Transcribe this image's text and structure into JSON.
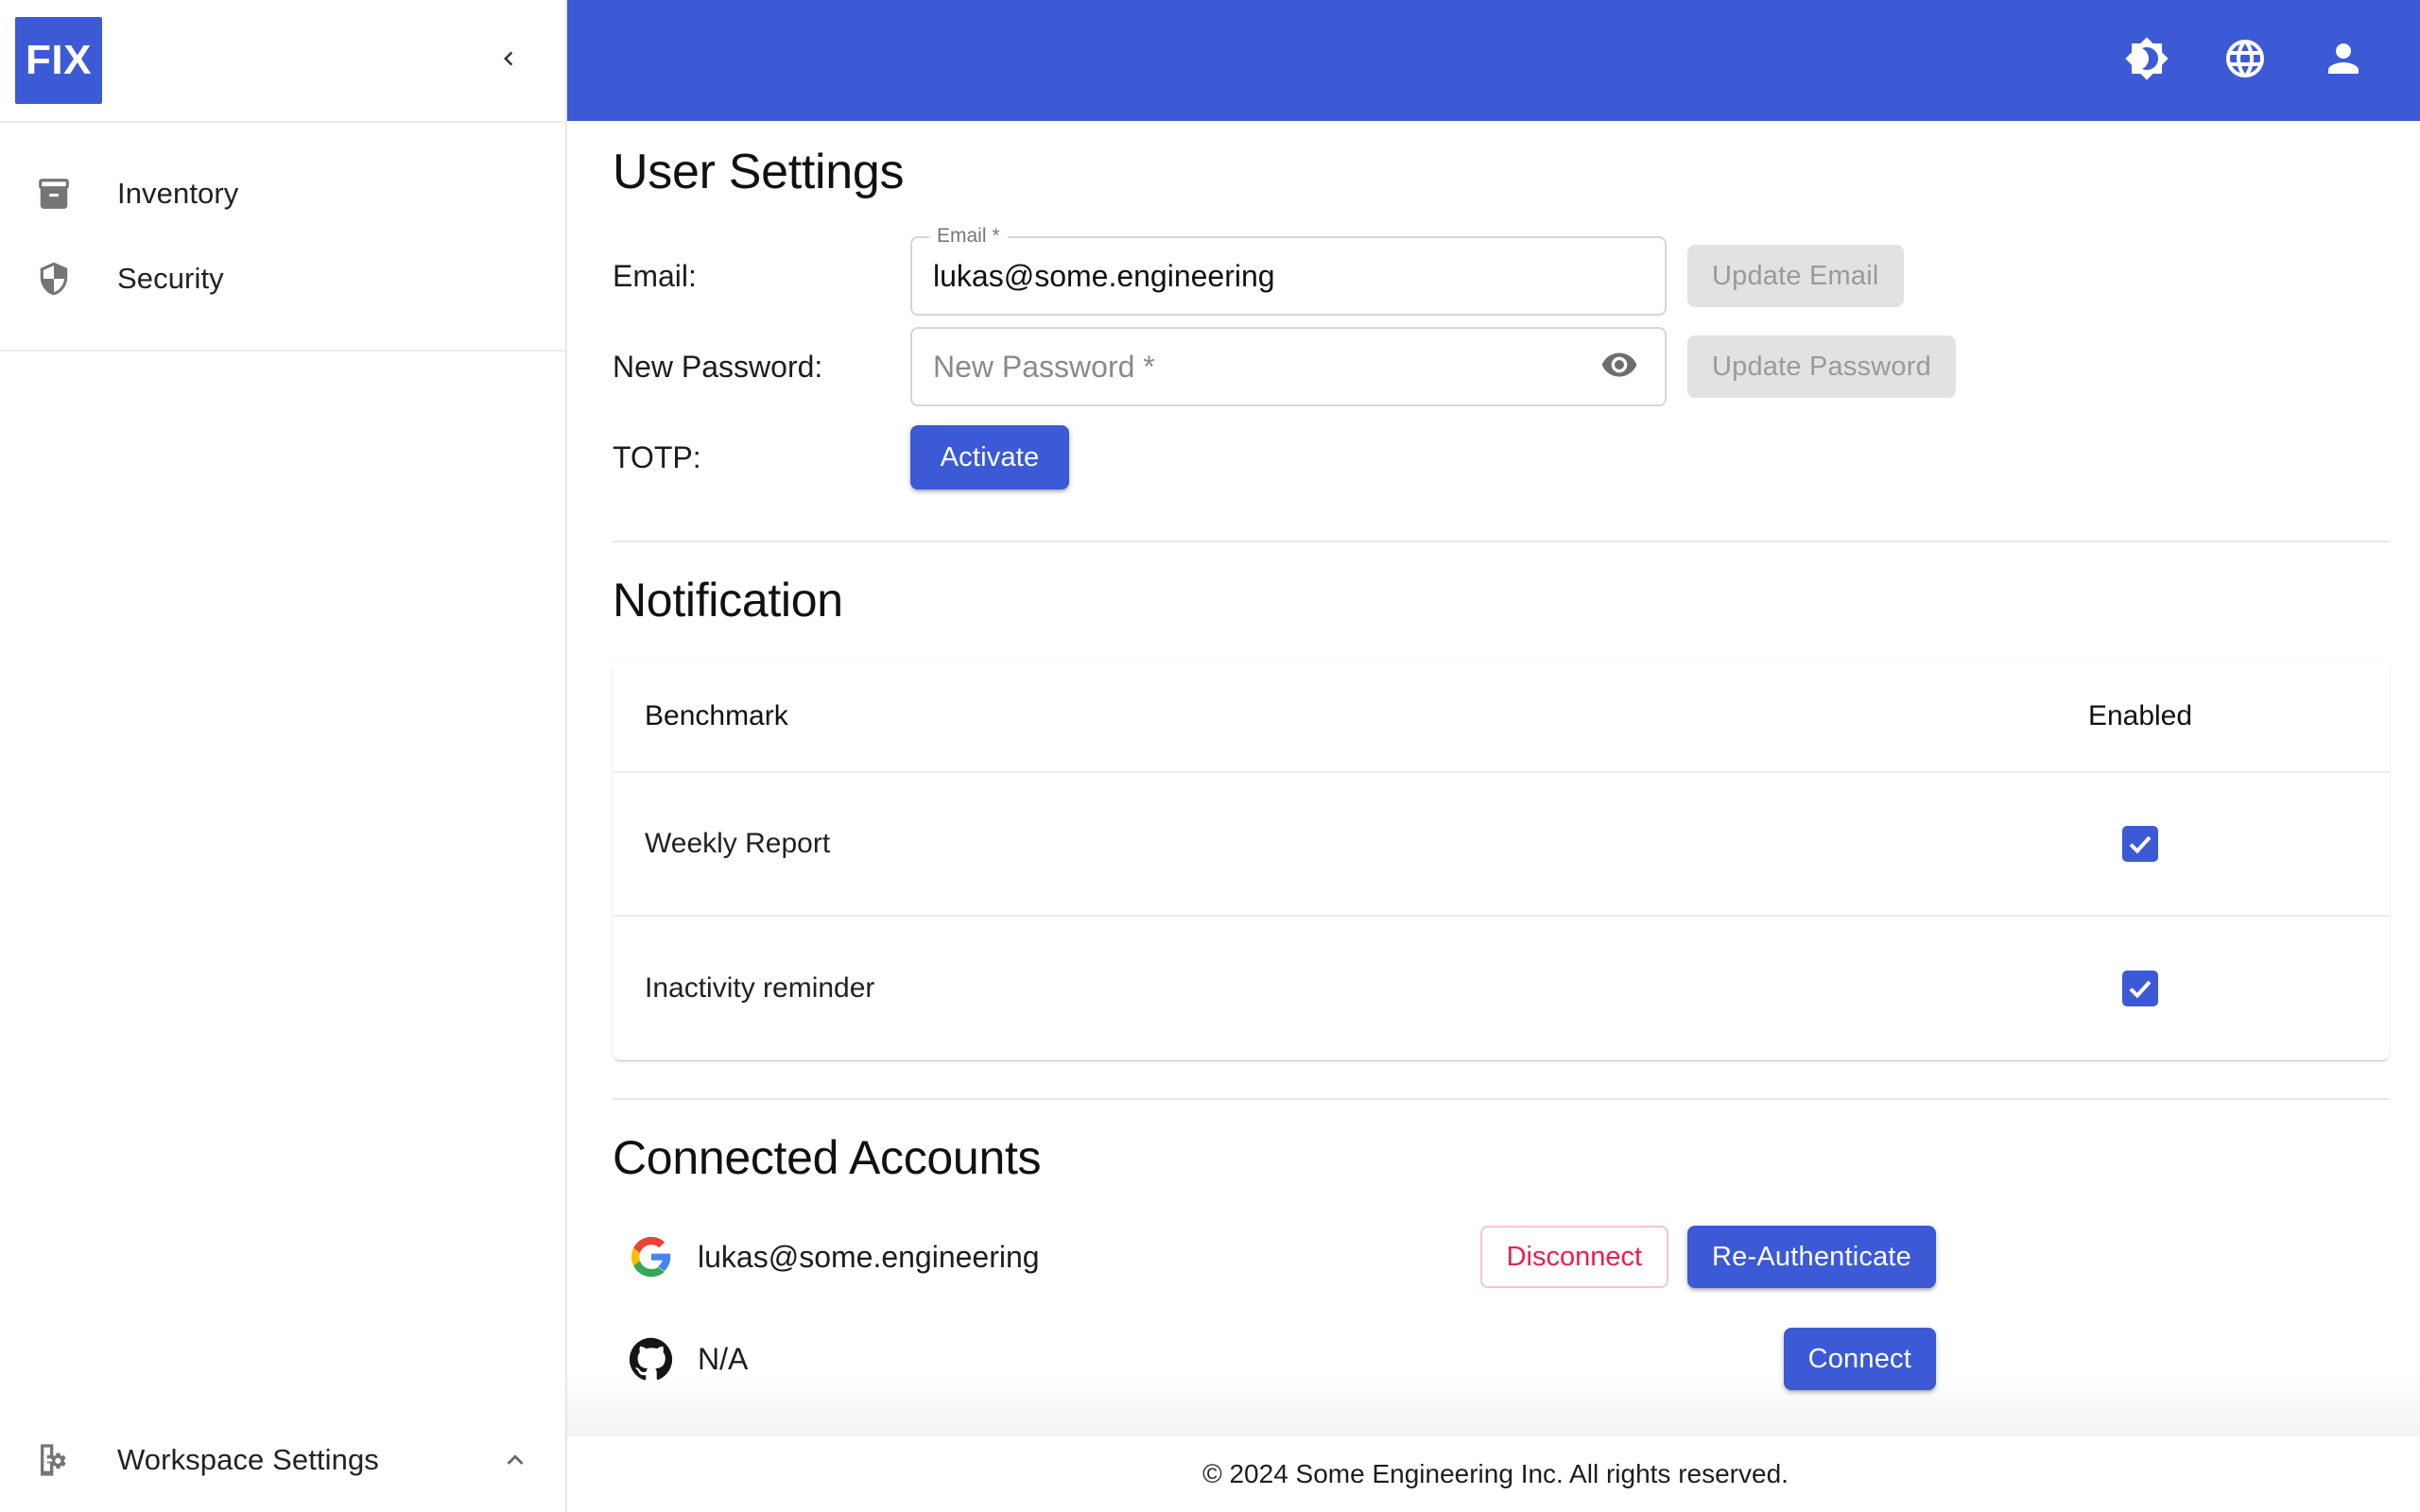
{
  "brand": {
    "logo_text": "FIX",
    "accent_color": "#3c5ad5"
  },
  "sidebar": {
    "collapse_icon": "chevron-left-icon",
    "items": [
      {
        "label": "Inventory",
        "icon": "inventory-icon"
      },
      {
        "label": "Security",
        "icon": "shield-icon"
      }
    ],
    "bottom": {
      "label": "Workspace Settings",
      "icon": "workspace-settings-icon",
      "chevron": "chevron-up-icon"
    }
  },
  "topbar": {
    "icons": [
      {
        "name": "dark-mode-icon"
      },
      {
        "name": "language-globe-icon"
      },
      {
        "name": "account-person-icon"
      }
    ]
  },
  "user_settings": {
    "title": "User Settings",
    "email": {
      "row_label": "Email:",
      "field_legend": "Email *",
      "value": "lukas@some.engineering",
      "button_label": "Update Email",
      "button_disabled": true
    },
    "password": {
      "row_label": "New Password:",
      "placeholder": "New Password *",
      "value": "",
      "toggle_icon": "eye-icon",
      "button_label": "Update Password",
      "button_disabled": true
    },
    "totp": {
      "row_label": "TOTP:",
      "button_label": "Activate"
    }
  },
  "notification": {
    "title": "Notification",
    "columns": [
      "Benchmark",
      "Enabled"
    ],
    "rows": [
      {
        "benchmark": "Weekly Report",
        "enabled": true
      },
      {
        "benchmark": "Inactivity reminder",
        "enabled": true
      }
    ]
  },
  "connected_accounts": {
    "title": "Connected Accounts",
    "accounts": [
      {
        "provider": "google",
        "icon": "google-icon",
        "name": "lukas@some.engineering",
        "actions": [
          {
            "label": "Disconnect",
            "style": "outline-danger"
          },
          {
            "label": "Re-Authenticate",
            "style": "primary"
          }
        ]
      },
      {
        "provider": "github",
        "icon": "github-icon",
        "name": "N/A",
        "actions": [
          {
            "label": "Connect",
            "style": "primary"
          }
        ]
      }
    ]
  },
  "footer": {
    "copyright": "© 2024 Some Engineering Inc. All rights reserved."
  }
}
